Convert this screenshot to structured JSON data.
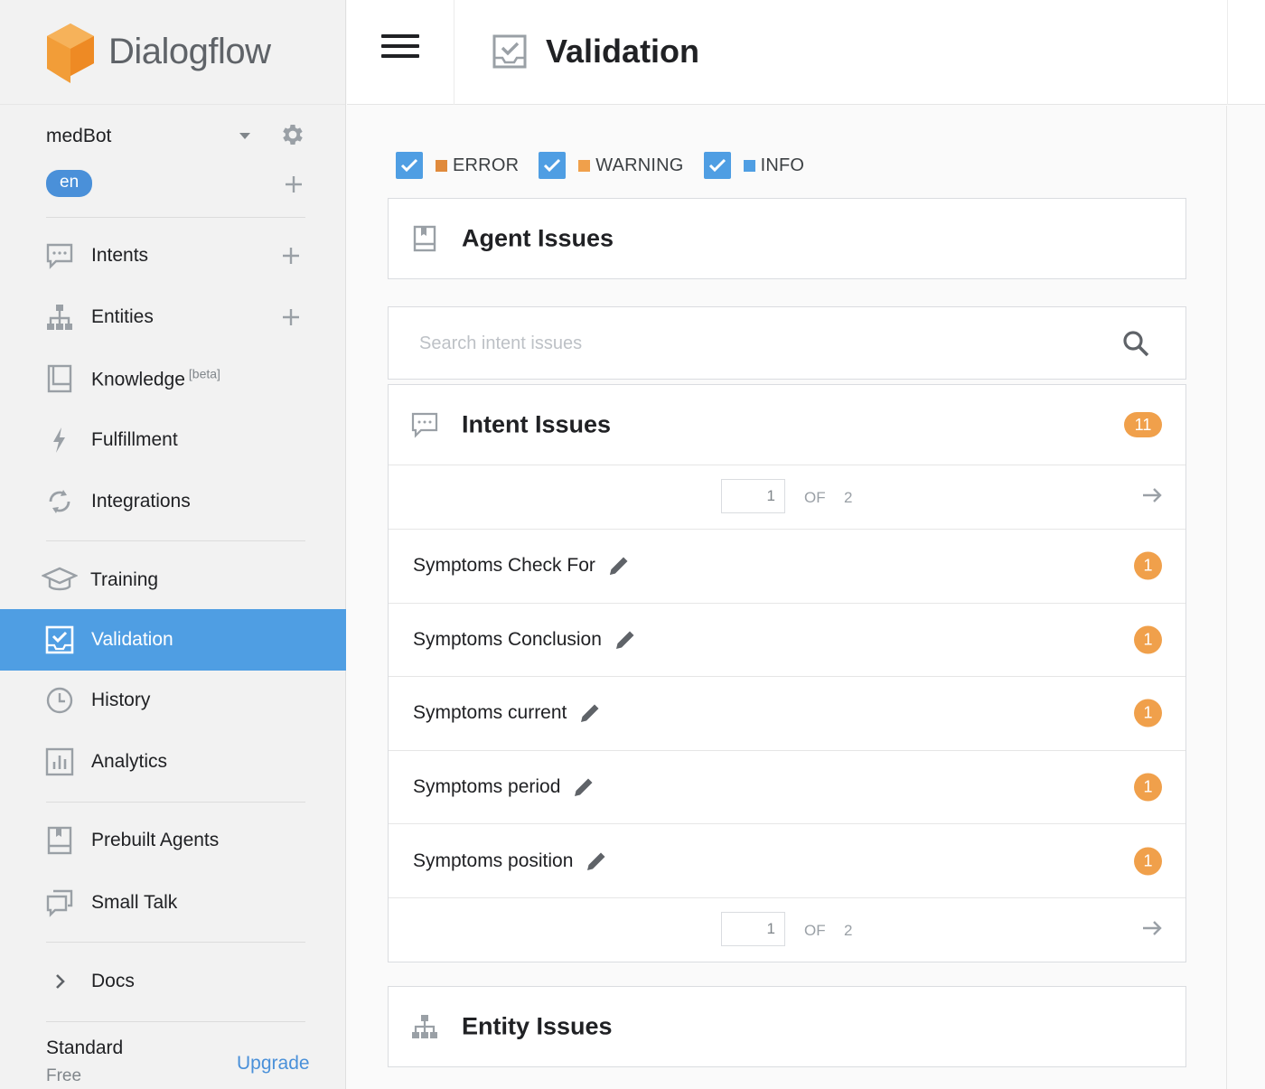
{
  "brand": {
    "name": "Dialogflow",
    "logo_color": "#f29d38"
  },
  "agent": {
    "name": "medBot",
    "language": "en"
  },
  "nav": {
    "intents": "Intents",
    "entities": "Entities",
    "knowledge": "Knowledge",
    "knowledge_tag": "[beta]",
    "fulfillment": "Fulfillment",
    "integrations": "Integrations",
    "training": "Training",
    "validation": "Validation",
    "history": "History",
    "analytics": "Analytics",
    "prebuilt_agents": "Prebuilt Agents",
    "small_talk": "Small Talk",
    "docs": "Docs"
  },
  "plan": {
    "name": "Standard",
    "tier": "Free",
    "upgrade": "Upgrade"
  },
  "header": {
    "title": "Validation"
  },
  "filters": [
    {
      "label": "ERROR",
      "checked": true,
      "color": "#e08a3c"
    },
    {
      "label": "WARNING",
      "checked": true,
      "color": "#f0a04b"
    },
    {
      "label": "INFO",
      "checked": true,
      "color": "#4f9ee3"
    }
  ],
  "agent_issues": {
    "title": "Agent Issues"
  },
  "search": {
    "placeholder": "Search intent issues"
  },
  "intent_issues": {
    "title": "Intent Issues",
    "count": "11",
    "pager": {
      "current": "1",
      "of_label": "OF",
      "total": "2"
    },
    "rows": [
      {
        "name": "Symptoms Check For",
        "count": "1"
      },
      {
        "name": "Symptoms Conclusion",
        "count": "1"
      },
      {
        "name": "Symptoms current",
        "count": "1"
      },
      {
        "name": "Symptoms period",
        "count": "1"
      },
      {
        "name": "Symptoms position",
        "count": "1"
      }
    ]
  },
  "entity_issues": {
    "title": "Entity Issues"
  },
  "colors": {
    "accent": "#4f9ee3",
    "badge": "#f0a04b",
    "link": "#4a90d9"
  }
}
